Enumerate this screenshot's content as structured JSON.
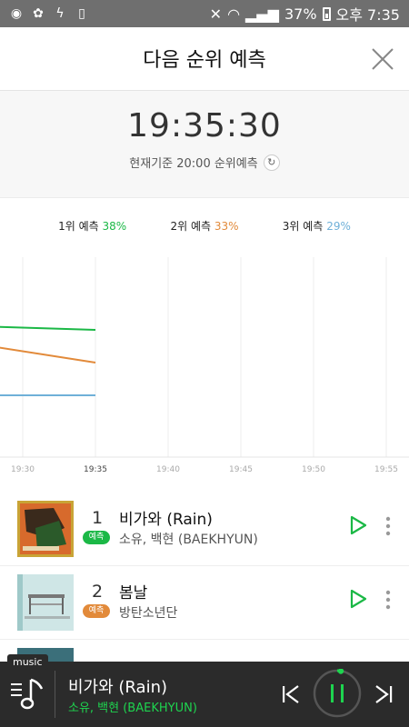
{
  "status": {
    "battery": "37%",
    "time": "오후 7:35"
  },
  "header": {
    "title": "다음 순위 예측"
  },
  "timebox": {
    "clock": "19:35:30",
    "basis": "현재기준 20:00 순위예측"
  },
  "predictions": [
    {
      "label": "1위 예측",
      "pct": "38%",
      "color": "#1bb846"
    },
    {
      "label": "2위 예측",
      "pct": "33%",
      "color": "#e28a3a"
    },
    {
      "label": "3위 예측",
      "pct": "29%",
      "color": "#6fb0d8"
    }
  ],
  "chart_data": {
    "type": "line",
    "categories": [
      "19:30",
      "19:35",
      "19:40",
      "19:45",
      "19:50",
      "19:55"
    ],
    "series": [
      {
        "color": "#1bb846",
        "x": [
          "19:27",
          "19:35"
        ],
        "values": [
          38,
          37.5
        ]
      },
      {
        "color": "#e28a3a",
        "x": [
          "19:27",
          "19:35"
        ],
        "values": [
          35.5,
          33
        ]
      },
      {
        "color": "#6fb0d8",
        "x": [
          "19:27",
          "19:35"
        ],
        "values": [
          28.5,
          28.5
        ]
      }
    ],
    "grid": true
  },
  "songs": [
    {
      "rank": "1",
      "badge": "예측",
      "badge_color": "#1bb846",
      "title": "비가와 (Rain)",
      "artist": "소유, 백현 (BAEKHYUN)"
    },
    {
      "rank": "2",
      "badge": "예측",
      "badge_color": "#e28a3a",
      "title": "봄날",
      "artist": "방탄소년단"
    }
  ],
  "player": {
    "tag": "music",
    "title": "비가와 (Rain)",
    "artist": "소유, 백현 (BAEKHYUN)"
  }
}
